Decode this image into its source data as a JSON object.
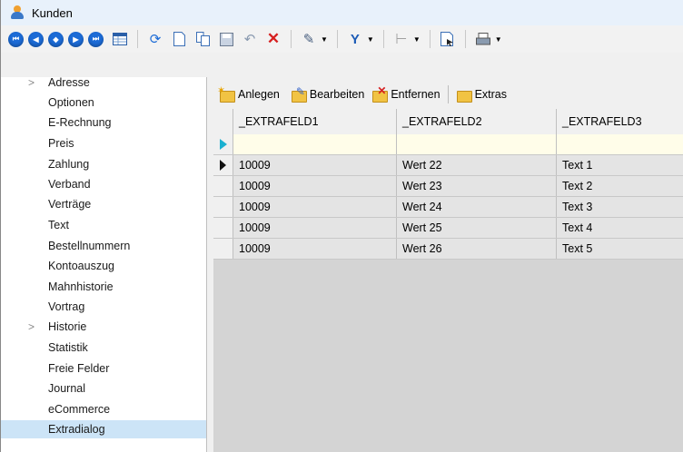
{
  "window": {
    "title": "Kunden"
  },
  "toolbar": {
    "nav_buttons": [
      "first",
      "previous",
      "search",
      "next",
      "last"
    ],
    "icons": [
      "table-icon",
      "refresh-icon",
      "new-document-icon",
      "copy-icon",
      "save-icon",
      "undo-icon",
      "delete-icon",
      "tools-icon",
      "filter-icon",
      "tree-icon",
      "export-icon",
      "print-icon"
    ]
  },
  "sidebar": {
    "items": [
      {
        "label": "Adresse",
        "expandable": true
      },
      {
        "label": "Optionen"
      },
      {
        "label": "E-Rechnung"
      },
      {
        "label": "Preis"
      },
      {
        "label": "Zahlung"
      },
      {
        "label": "Verband"
      },
      {
        "label": "Verträge"
      },
      {
        "label": "Text"
      },
      {
        "label": "Bestellnummern"
      },
      {
        "label": "Kontoauszug"
      },
      {
        "label": "Mahnhistorie"
      },
      {
        "label": "Vortrag"
      },
      {
        "label": "Historie",
        "expandable": true
      },
      {
        "label": "Statistik"
      },
      {
        "label": "Freie Felder"
      },
      {
        "label": "Journal"
      },
      {
        "label": "eCommerce"
      },
      {
        "label": "Extradialog",
        "selected": true
      }
    ]
  },
  "subtoolbar": {
    "anlegen": "Anlegen",
    "bearbeiten": "Bearbeiten",
    "entfernen": "Entfernen",
    "extras": "Extras"
  },
  "grid": {
    "columns": [
      "_EXTRAFELD1",
      "_EXTRAFELD2",
      "_EXTRAFELD3"
    ],
    "rows": [
      [
        "10009",
        "Wert 22",
        "Text 1"
      ],
      [
        "10009",
        "Wert 23",
        "Text 2"
      ],
      [
        "10009",
        "Wert 24",
        "Text 3"
      ],
      [
        "10009",
        "Wert 25",
        "Text 4"
      ],
      [
        "10009",
        "Wert 26",
        "Text 5"
      ]
    ]
  },
  "colors": {
    "selection": "#cce4f7",
    "new_row": "#fffde9",
    "nav_button": "#1c6bd6"
  }
}
